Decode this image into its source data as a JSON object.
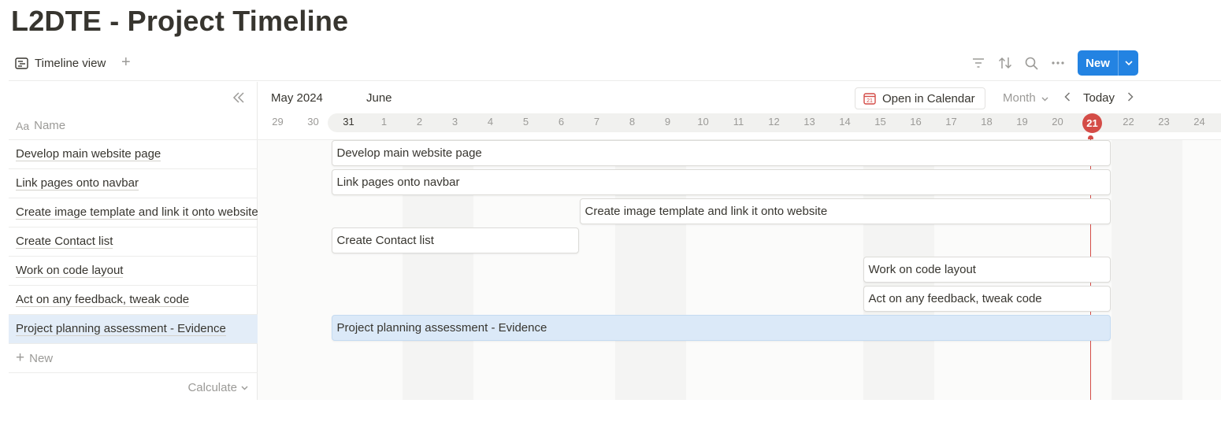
{
  "page": {
    "title": "L2DTE - Project Timeline"
  },
  "viewbar": {
    "tab_label": "Timeline view",
    "add_symbol": "+",
    "new_label": "New"
  },
  "table": {
    "name_header": "Name",
    "name_header_prefix": "Aa",
    "rows": [
      {
        "label": "Develop main website page"
      },
      {
        "label": "Link pages onto navbar"
      },
      {
        "label": "Create image template and link it onto website"
      },
      {
        "label": "Create Contact list"
      },
      {
        "label": "Work on code layout"
      },
      {
        "label": "Act on any feedback, tweak code"
      },
      {
        "label": "Project planning assessment - Evidence"
      }
    ],
    "new_row_label": "New",
    "calculate_label": "Calculate"
  },
  "timeline": {
    "month_prev": "May 2024",
    "month_curr": "June",
    "open_calendar_label": "Open in Calendar",
    "calendar_icon_day": "21",
    "scale_label": "Month",
    "today_label": "Today",
    "days": [
      "29",
      "30",
      "31",
      "1",
      "2",
      "3",
      "4",
      "5",
      "6",
      "7",
      "8",
      "9",
      "10",
      "11",
      "12",
      "13",
      "14",
      "15",
      "16",
      "17",
      "18",
      "19",
      "20",
      "21",
      "22",
      "23",
      "24"
    ],
    "today_index": 23,
    "today_day": "21",
    "bars": [
      {
        "label": "Develop main website page",
        "start_index": 2,
        "end_index": 23
      },
      {
        "label": "Link pages onto navbar",
        "start_index": 2,
        "end_index": 23
      },
      {
        "label": "Create image template and link it onto website",
        "start_index": 9,
        "end_index": 23
      },
      {
        "label": "Create Contact list",
        "start_index": 2,
        "end_index": 8
      },
      {
        "label": "Work on code layout",
        "start_index": 17,
        "end_index": 23
      },
      {
        "label": "Act on any feedback, tweak code",
        "start_index": 17,
        "end_index": 23
      },
      {
        "label": "Project planning assessment - Evidence",
        "start_index": 2,
        "end_index": 23
      }
    ]
  },
  "colors": {
    "accent": "#2383e2",
    "today": "#d44c47",
    "selected_row": "#e3edf8"
  }
}
